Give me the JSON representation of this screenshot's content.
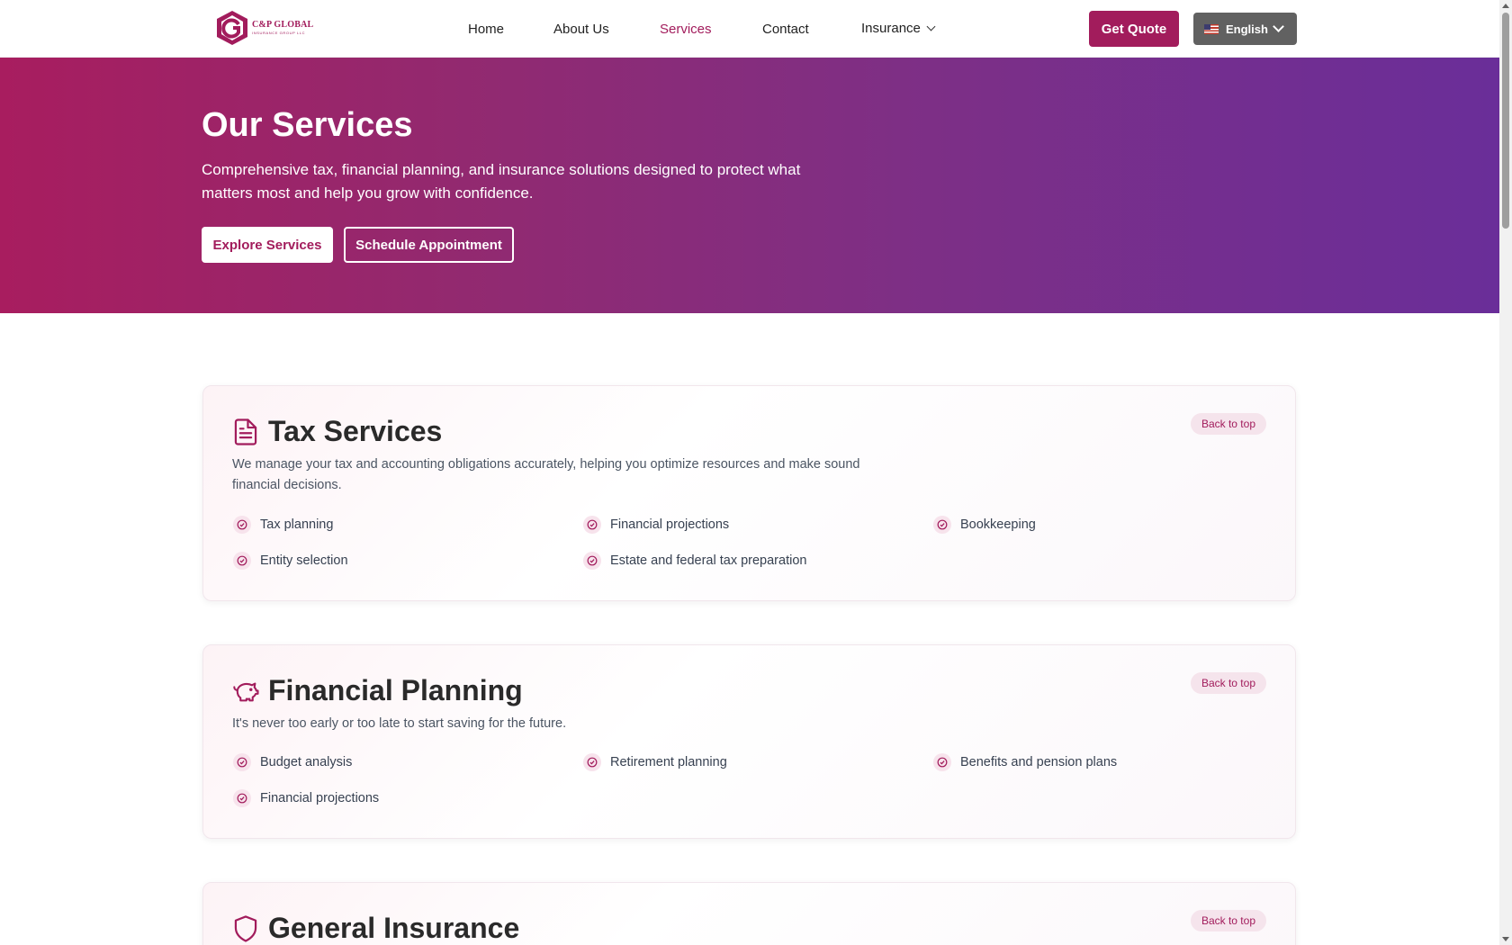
{
  "header": {
    "logo_name": "C&P GLOBAL",
    "logo_sub": "INSURANCE GROUP LLC",
    "nav": [
      {
        "label": "Home",
        "active": false
      },
      {
        "label": "About Us",
        "active": false
      },
      {
        "label": "Services",
        "active": true
      },
      {
        "label": "Contact",
        "active": false
      },
      {
        "label": "Insurance",
        "active": false,
        "has_dropdown": true
      }
    ],
    "quote_label": "Get Quote",
    "language": "English"
  },
  "hero": {
    "title": "Our Services",
    "subtitle": "Comprehensive tax, financial planning, and insurance solutions designed to protect what matters most and help you grow with confidence.",
    "btn_explore": "Explore Services",
    "btn_schedule": "Schedule Appointment"
  },
  "sections": [
    {
      "title": "Tax Services",
      "icon": "document-icon",
      "back_to_top": "Back to top",
      "description": "We manage your tax and accounting obligations accurately, helping you optimize resources and make sound financial decisions.",
      "items": [
        "Tax planning",
        "Financial projections",
        "Bookkeeping",
        "Entity selection",
        "Estate and federal tax preparation"
      ]
    },
    {
      "title": "Financial Planning",
      "icon": "piggy-bank-icon",
      "back_to_top": "Back to top",
      "description": "It's never too early or too late to start saving for the future.",
      "items": [
        "Budget analysis",
        "Retirement planning",
        "Benefits and pension plans",
        "Financial projections"
      ]
    },
    {
      "title": "General Insurance",
      "icon": "shield-icon",
      "back_to_top": "Back to top"
    }
  ],
  "colors": {
    "brand": "#a21c5c",
    "hero_start": "#a81d5f",
    "hero_end": "#6a2e99",
    "language_bg": "#616161"
  }
}
